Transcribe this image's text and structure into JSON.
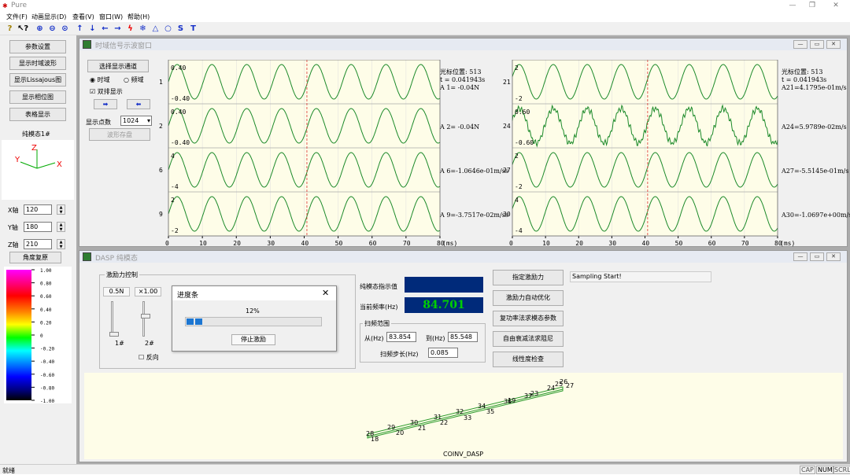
{
  "app": {
    "title": "Pure",
    "window_controls": [
      "—",
      "❐",
      "✕"
    ]
  },
  "menu": [
    "文件(F)",
    "动画显示(D)",
    "查看(V)",
    "窗口(W)",
    "帮助(H)"
  ],
  "toolbar_icons": [
    "help-icon",
    "context-help-icon",
    "zoom-in-icon",
    "zoom-out-icon",
    "zoom-fit-icon",
    "arrow-up-icon",
    "arrow-down-icon",
    "arrow-left-icon",
    "arrow-right-icon",
    "lightning-icon",
    "snowflake-icon",
    "triangle-icon",
    "circle-icon",
    "s-icon",
    "t-icon"
  ],
  "left": {
    "buttons": [
      "参数设置",
      "显示时域波形",
      "显示Lissajous图",
      "显示相位图",
      "表格显示"
    ],
    "mode_label": "纯模态1#",
    "axes": {
      "x": "X",
      "y": "Y",
      "z": "Z"
    },
    "x_label": "X轴",
    "x_value": "120",
    "y_label": "Y轴",
    "y_value": "180",
    "z_label": "Z轴",
    "z_value": "210",
    "reset_button": "角度复原",
    "colorbar_ticks": [
      "1.00",
      "0.80",
      "0.60",
      "0.40",
      "0.20",
      "0",
      "-0.20",
      "-0.40",
      "-0.60",
      "-0.80",
      "-1.00"
    ]
  },
  "time_window": {
    "title": "时域信号示波窗口",
    "select_channel": "选择显示通道",
    "radio_time": "时域",
    "radio_freq": "频域",
    "dual_display": "双排显示",
    "points_label": "显示点数",
    "points_value": "1024",
    "save_button": "波形存盘",
    "x_ticks": [
      "0",
      "10",
      "20",
      "30",
      "40",
      "50",
      "60",
      "70",
      "80"
    ],
    "x_unit": "(ms)",
    "left_channels": [
      {
        "id": "1",
        "top": "0.40",
        "bot": "-0.40",
        "readout": "A 1=      -0.04N"
      },
      {
        "id": "2",
        "top": "0.40",
        "bot": "-0.40",
        "readout": "A 2=      -0.04N"
      },
      {
        "id": "6",
        "top": "4",
        "bot": "-4",
        "readout": "A 6=-1.0646e-01m/ss"
      },
      {
        "id": "9",
        "top": "2",
        "bot": "-2",
        "readout": "A 9=-3.7517e-02m/ss"
      }
    ],
    "right_channels": [
      {
        "id": "21",
        "top": "2",
        "bot": "-2",
        "readout": "A21=4.1795e-01m/s"
      },
      {
        "id": "24",
        "top": "0.60",
        "bot": "-0.60",
        "readout": "A24=5.9789e-02m/s"
      },
      {
        "id": "27",
        "top": "2",
        "bot": "-2",
        "readout": "A27=-5.5145e-01m/s"
      },
      {
        "id": "30",
        "top": "4",
        "bot": "-4",
        "readout": "A30=-1.0697e+00m/s"
      }
    ],
    "cursor_label": "光标位置: 513",
    "cursor_time": "t  =   0.041943s"
  },
  "dasp_window": {
    "title": "DASP 纯模态",
    "group_excitation": "激励力控制",
    "slider1_value": "0.5N",
    "slider2_value": "×1.00",
    "slider1_label": "1#",
    "slider2_label": "2#",
    "reverse_label": "反向",
    "indicator_label": "纯模态指示值",
    "freq_label": "当前频率(Hz)",
    "freq_value": "84.701",
    "sweep_group": "扫频范围",
    "from_label": "从(Hz)",
    "from_value": "83.854",
    "to_label": "到(Hz)",
    "to_value": "85.548",
    "step_label": "扫频步长(Hz)",
    "step_value": "0.085",
    "buttons": [
      "指定激励力",
      "激励力自动优化",
      "复功率法求模态参数",
      "自由衰减法求阻尼",
      "线性度检查"
    ],
    "log_text": "Sampling Start!",
    "model_caption": "COINV_DASP",
    "model_nodes_bottom": [
      "28",
      "18",
      "29",
      "20",
      "30",
      "21",
      "31",
      "22",
      "32",
      "33",
      "34",
      "35",
      "36",
      "37"
    ],
    "model_nodes_top": [
      "19",
      "23",
      "24",
      "25",
      "26",
      "27"
    ]
  },
  "progress_dialog": {
    "title": "进度条",
    "percent_text": "12%",
    "progress": 0.12,
    "stop_button": "停止激励"
  },
  "status": {
    "text": "就绪",
    "indicators": [
      "CAP",
      "NUM",
      "SCRL"
    ]
  }
}
